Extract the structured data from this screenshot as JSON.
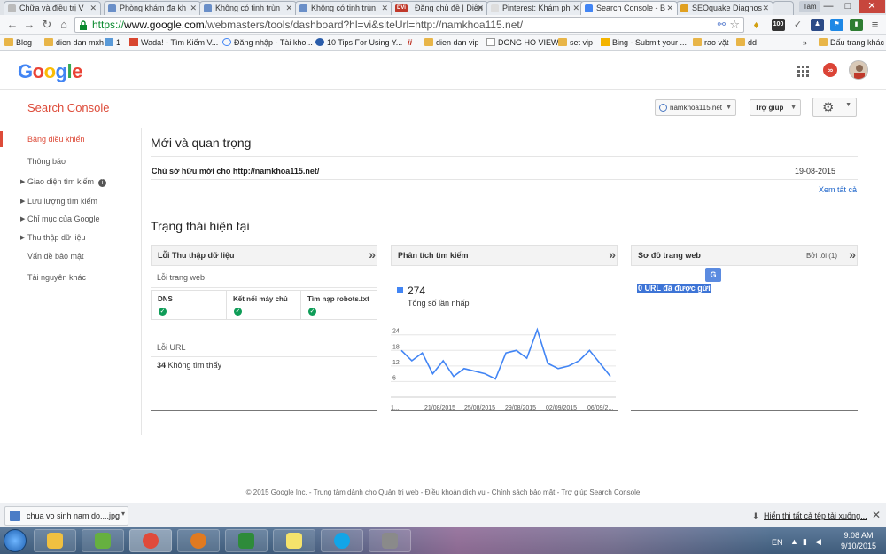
{
  "browser": {
    "tabs": [
      {
        "label": "Chữa và điều trị V",
        "color": "#888888"
      },
      {
        "label": "Phòng khám đa kh",
        "color": "#6a8fc8"
      },
      {
        "label": "Không có tinh trùn",
        "color": "#6a8fc8"
      },
      {
        "label": "Không có tinh trùn",
        "color": "#6a8fc8"
      },
      {
        "label": "Đăng chủ đề | Diễn",
        "color": "#c0392b",
        "badge": "DVi"
      },
      {
        "label": "Pinterest: Khám ph",
        "color": "#6a8fc8"
      },
      {
        "label": "Search Console - B",
        "color": "#4285f4"
      },
      {
        "label": "SEOquake Diagnos",
        "color": "#e0a020"
      }
    ],
    "user": "Tam",
    "window_controls": {
      "minimize": "—",
      "maximize": "□",
      "close": "✕"
    },
    "url": {
      "protocol": "https://",
      "host": "www.google.com",
      "path": "/webmasters/tools/dashboard?hl=vi&siteUrl=http://namkhoa115.net/"
    },
    "extensions": [
      "100",
      "♦",
      "✓",
      "♟",
      "⚑",
      "▮"
    ],
    "bookmarks": [
      {
        "label": "Blog",
        "icon": "folder"
      },
      {
        "label": "dien dan mxh",
        "icon": "folder"
      },
      {
        "label": "1",
        "icon": "gauge"
      },
      {
        "label": "Wada! - Tìm Kiếm V...",
        "icon": "wada"
      },
      {
        "label": "Đăng nhập - Tài kho...",
        "icon": "google"
      },
      {
        "label": "10 Tips For Using Y...",
        "icon": "gear"
      },
      {
        "label": "ii",
        "icon": "ii"
      },
      {
        "label": "dien dan vip",
        "icon": "folder"
      },
      {
        "label": "DONG HO VIEW",
        "icon": "page"
      },
      {
        "label": "set vip",
        "icon": "folder"
      },
      {
        "label": "Bing - Submit your ...",
        "icon": "bing"
      },
      {
        "label": "rao vặt",
        "icon": "folder"
      },
      {
        "label": "dd",
        "icon": "folder"
      },
      {
        "label": "»",
        "icon": "none"
      },
      {
        "label": "Dấu trang khác",
        "icon": "folder"
      }
    ]
  },
  "header": {
    "logo": "Google",
    "logo_colors": [
      "#4285f4",
      "#ea4335",
      "#fbbc05",
      "#4285f4",
      "#34a853",
      "#ea4335"
    ],
    "notifications_label": "∞"
  },
  "console": {
    "title": "Search Console",
    "site_selector": "namkhoa115.net",
    "help_label": "Trợ giúp"
  },
  "sidebar": {
    "items": [
      {
        "label": "Bảng điều khiển",
        "active": true,
        "expandable": false
      },
      {
        "label": "Thông báo",
        "active": false,
        "expandable": false
      },
      {
        "label": "Giao diện tìm kiếm",
        "active": false,
        "expandable": true,
        "info": "i"
      },
      {
        "label": "Lưu lượng tìm kiếm",
        "active": false,
        "expandable": true
      },
      {
        "label": "Chỉ mục của Google",
        "active": false,
        "expandable": true
      },
      {
        "label": "Thu thập dữ liệu",
        "active": false,
        "expandable": true
      },
      {
        "label": "Vấn đề bảo mật",
        "active": false,
        "expandable": false
      },
      {
        "label": "Tài nguyên khác",
        "active": false,
        "expandable": false
      }
    ]
  },
  "main": {
    "new_important_title": "Mới và quan trọng",
    "message": "Chủ sở hữu mới cho http://namkhoa115.net/",
    "message_date": "19-08-2015",
    "see_all": "Xem tất cả",
    "current_status_title": "Trạng thái hiện tại",
    "crawl_errors": {
      "title": "Lỗi Thu thập dữ liệu",
      "site_errors_label": "Lỗi trang web",
      "checks": [
        "DNS",
        "Kết nối máy chủ",
        "Tìm nạp robots.txt"
      ],
      "check_ok": "✓",
      "url_errors_label": "Lỗi URL",
      "not_found_count": "34",
      "not_found_label": "Không tìm thấy"
    },
    "search_analytics": {
      "title": "Phân tích tìm kiếm",
      "total_clicks": "274",
      "total_clicks_label": "Tổng số lần nhấp"
    },
    "sitemaps": {
      "title": "Sơ đồ trang web",
      "meta": "Bởi tôi (1)",
      "translate_badge": "G",
      "urls_submitted": "0 URL đã được gửi"
    },
    "more_arrow": "»"
  },
  "chart_data": {
    "type": "line",
    "color": "#4285f4",
    "x_tick_labels": [
      "1...",
      "21/08/2015",
      "25/08/2015",
      "29/08/2015",
      "02/09/2015",
      "06/09/2..."
    ],
    "y_ticks": [
      24,
      18,
      12,
      6
    ],
    "ylim": [
      0,
      28
    ],
    "grid": true,
    "values": [
      18,
      14,
      17,
      9,
      14,
      8,
      11,
      10,
      9,
      7,
      17,
      18,
      15,
      26,
      13,
      11,
      12,
      14,
      18,
      13,
      8
    ]
  },
  "footer": {
    "text": "© 2015 Google Inc. - Trung tâm dành cho Quản trị web - Điều khoản dịch vụ - Chính sách bảo mật - Trợ giúp Search Console"
  },
  "download_bar": {
    "file_name": "chua vo sinh nam do....jpg",
    "show_all": "Hiển thị tất cả tệp tải xuống...",
    "close": "✕"
  },
  "taskbar": {
    "language": "EN",
    "time": "9:08 AM",
    "date": "9/10/2015",
    "apps": [
      {
        "name": "explorer",
        "color": "#f0c040"
      },
      {
        "name": "media",
        "color": "#66b040"
      },
      {
        "name": "chrome",
        "color": "#e04a3a"
      },
      {
        "name": "firefox",
        "color": "#e07a20"
      },
      {
        "name": "excel",
        "color": "#2e8b3a"
      },
      {
        "name": "sticky",
        "color": "#f5e36b"
      },
      {
        "name": "skype",
        "color": "#12a5e8"
      },
      {
        "name": "chart-tool",
        "color": "#8a8a8a"
      }
    ]
  }
}
